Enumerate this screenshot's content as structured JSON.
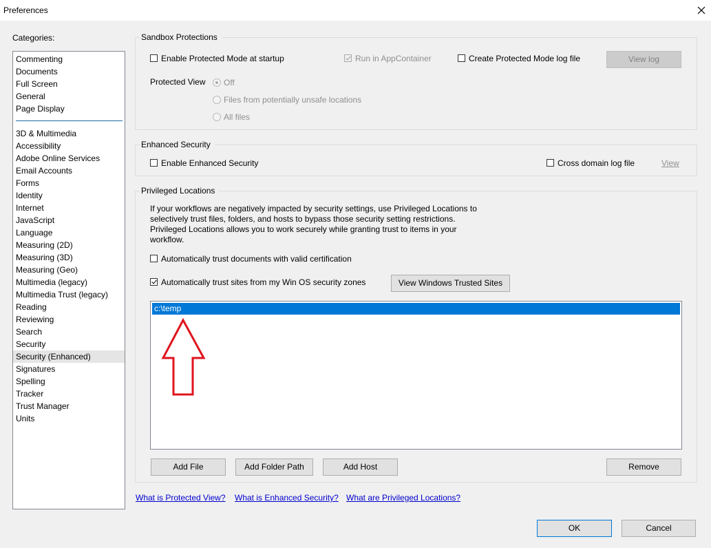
{
  "window": {
    "title": "Preferences"
  },
  "categories": {
    "label": "Categories:",
    "group1": [
      "Commenting",
      "Documents",
      "Full Screen",
      "General",
      "Page Display"
    ],
    "group2": [
      "3D & Multimedia",
      "Accessibility",
      "Adobe Online Services",
      "Email Accounts",
      "Forms",
      "Identity",
      "Internet",
      "JavaScript",
      "Language",
      "Measuring (2D)",
      "Measuring (3D)",
      "Measuring (Geo)",
      "Multimedia (legacy)",
      "Multimedia Trust (legacy)",
      "Reading",
      "Reviewing",
      "Search",
      "Security",
      "Security (Enhanced)",
      "Signatures",
      "Spelling",
      "Tracker",
      "Trust Manager",
      "Units"
    ],
    "selected": "Security (Enhanced)"
  },
  "sandbox": {
    "legend": "Sandbox Protections",
    "protected_mode_label": "Enable Protected Mode at startup",
    "protected_mode_checked": false,
    "appcontainer_label": "Run in AppContainer",
    "appcontainer_checked": true,
    "log_file_label": "Create Protected Mode log file",
    "log_file_checked": false,
    "view_log": "View log",
    "protected_view_label": "Protected View",
    "pv_off": "Off",
    "pv_unsafe": "Files from potentially unsafe locations",
    "pv_all": "All files"
  },
  "enhanced": {
    "legend": "Enhanced Security",
    "enable_label": "Enable Enhanced Security",
    "enable_checked": false,
    "cross_domain_label": "Cross domain log file",
    "cross_domain_checked": false,
    "view": "View"
  },
  "privileged": {
    "legend": "Privileged Locations",
    "description": "If your workflows are negatively impacted by security settings, use Privileged Locations to selectively trust files, folders, and hosts to bypass those security setting restrictions. Privileged Locations allows you to work securely while granting trust to items in your workflow.",
    "auto_cert_label": "Automatically trust documents with valid certification",
    "auto_cert_checked": false,
    "auto_sites_label": "Automatically trust sites from my Win OS security zones",
    "auto_sites_checked": true,
    "view_trusted_sites": "View Windows Trusted Sites",
    "locations": [
      "c:\\temp"
    ],
    "add_file": "Add File",
    "add_folder": "Add Folder Path",
    "add_host": "Add Host",
    "remove": "Remove"
  },
  "links": {
    "protected_view": "What is Protected View?",
    "enhanced_security": "What is Enhanced Security?",
    "privileged_locations": "What are Privileged Locations?"
  },
  "footer": {
    "ok": "OK",
    "cancel": "Cancel"
  },
  "colors": {
    "selection": "#0078d7",
    "annotation_arrow": "#e0141e"
  }
}
